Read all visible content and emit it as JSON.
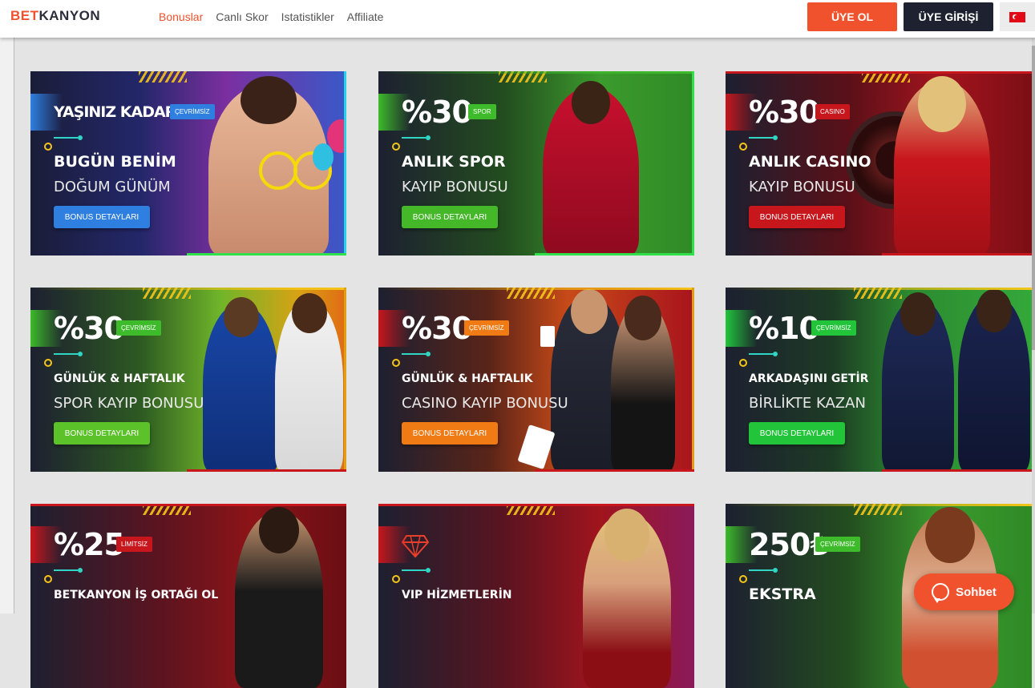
{
  "header": {
    "logo_bet": "BET",
    "logo_kanyon": "KANYON",
    "nav": [
      "Bonuslar",
      "Canlı Skor",
      "Istatistikler",
      "Affiliate"
    ],
    "signup": "ÜYE OL",
    "login": "ÜYE GİRİŞİ",
    "language_icon": "turkey-flag-icon"
  },
  "cards": [
    {
      "headline": "YAŞINIZ KADAR",
      "tag": "ÇEVRİMSİZ",
      "line1": "BUGÜN BENİM",
      "line2": "DOĞUM GÜNÜM",
      "button": "BONUS DETAYLARI",
      "accent": "#2f7fe0"
    },
    {
      "headline": "%30",
      "tag": "SPOR",
      "line1": "ANLIK SPOR",
      "line2": "KAYIP BONUSU",
      "button": "BONUS DETAYLARI",
      "accent": "#3dbb2a"
    },
    {
      "headline": "%30",
      "tag": "CASINO",
      "line1": "ANLIK CASINO",
      "line2": "KAYIP BONUSU",
      "button": "BONUS DETAYLARI",
      "accent": "#c8161d"
    },
    {
      "headline": "%30",
      "tag": "ÇEVRİMSİZ",
      "line1": "GÜNLÜK & HAFTALIK",
      "line2": "SPOR KAYIP BONUSU",
      "button": "BONUS DETAYLARI",
      "accent": "#3dbb2a"
    },
    {
      "headline": "%30",
      "tag": "ÇEVRİMSİZ",
      "line1": "GÜNLÜK & HAFTALIK",
      "line2": "CASINO KAYIP BONUSU",
      "button": "BONUS DETAYLARI",
      "accent": "#f07a14"
    },
    {
      "headline": "%10",
      "tag": "ÇEVRİMSİZ",
      "line1": "ARKADAŞINI GETİR",
      "line2": "BİRLİKTE KAZAN",
      "button": "BONUS DETAYLARI",
      "accent": "#22c43a"
    },
    {
      "headline": "%25",
      "tag": "LİMİTSİZ",
      "line1": "BETKANYON İŞ ORTAĞI OL",
      "line2": "",
      "button": "",
      "accent": "#c8161d"
    },
    {
      "headline": "",
      "tag": "",
      "line1": "VIP HİZMETLERİN",
      "line2": "",
      "button": "",
      "accent": "#c8161d",
      "icon": "diamond-icon"
    },
    {
      "headline": "250₺",
      "tag": "ÇEVRİMSİZ",
      "line1": "EKSTRA",
      "line2": "",
      "button": "",
      "accent": "#3dbb2a"
    }
  ],
  "chat": {
    "label": "Sohbet",
    "icon": "chat-bubble-icon"
  }
}
